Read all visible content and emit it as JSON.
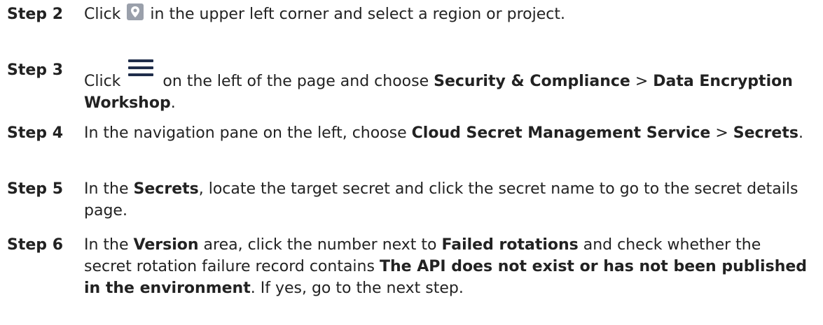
{
  "steps": [
    {
      "label": "Step 2",
      "parts": [
        "Click ",
        " in the upper left corner and select a region or project."
      ],
      "icon": "location-pin-icon"
    },
    {
      "label": "Step 3",
      "parts": [
        "Click ",
        " on the left of the page and choose ",
        "Security & Compliance",
        " > ",
        "Data Encryption Workshop",
        "."
      ],
      "icon": "hamburger-menu-icon"
    },
    {
      "label": "Step 4",
      "parts": [
        "In the navigation pane on the left, choose ",
        "Cloud Secret Management Service",
        " > ",
        "Secrets",
        "."
      ]
    },
    {
      "label": "Step 5",
      "parts": [
        "In the ",
        "Secrets",
        ", locate the target secret and click the secret name to go to the secret details page."
      ]
    },
    {
      "label": "Step 6",
      "parts": [
        "In the ",
        "Version",
        " area, click the number next to ",
        "Failed rotations",
        " and check whether the secret rotation failure record contains ",
        "The API does not exist or has not been published in the environment",
        ". If yes, go to the next step."
      ]
    }
  ]
}
